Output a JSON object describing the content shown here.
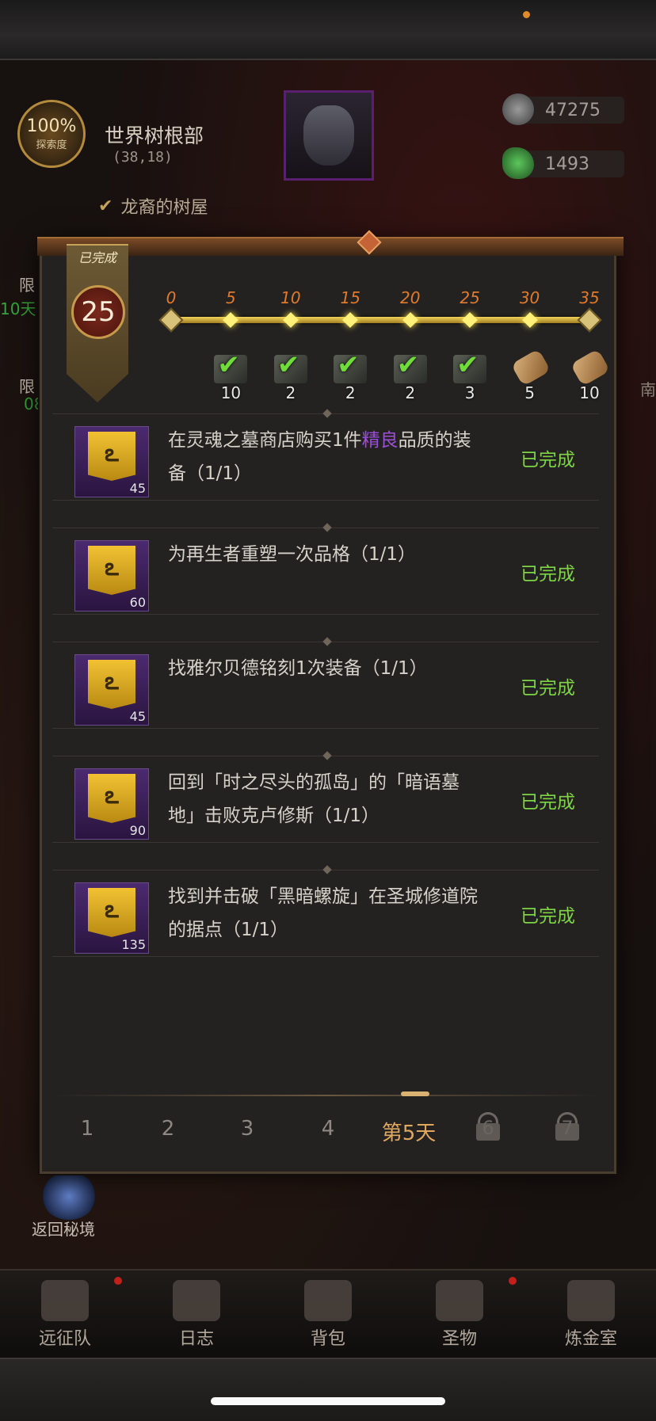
{
  "header": {
    "explore_pct": "100%",
    "explore_label": "探索度",
    "location_name": "世界树根部",
    "location_coords": "(38,18)",
    "sub_location": "龙裔的树屋",
    "currency": [
      {
        "icon": "ore-icon",
        "value": "47275"
      },
      {
        "icon": "emerald-icon",
        "value": "1493"
      }
    ]
  },
  "left_side": {
    "limited_1": "限",
    "limited_1_days": "10天",
    "limited_2": "限",
    "limited_2_days": "08",
    "return_label": "返回秘境"
  },
  "right_side": {
    "edge_text": "南"
  },
  "panel": {
    "banner_label": "已完成",
    "banner_value": "25",
    "progress": {
      "current": 35,
      "max": 35,
      "milestones": [
        "0",
        "5",
        "10",
        "15",
        "20",
        "25",
        "30",
        "35"
      ],
      "rewards": [
        {
          "milestone": "5",
          "count": "10",
          "type": "chest",
          "claimed": true
        },
        {
          "milestone": "10",
          "count": "2",
          "type": "chest",
          "claimed": true
        },
        {
          "milestone": "15",
          "count": "2",
          "type": "chest",
          "claimed": true
        },
        {
          "milestone": "20",
          "count": "2",
          "type": "chest",
          "claimed": true
        },
        {
          "milestone": "25",
          "count": "3",
          "type": "chest",
          "claimed": true
        },
        {
          "milestone": "30",
          "count": "5",
          "type": "scroll",
          "claimed": false
        },
        {
          "milestone": "35",
          "count": "10",
          "type": "scroll",
          "claimed": false
        }
      ]
    },
    "tasks": [
      {
        "reward": "45",
        "text_before": "在灵魂之墓商店购买1件",
        "text_highlight": "精良",
        "text_after": "品质的装备（1/1）",
        "status": "已完成"
      },
      {
        "reward": "60",
        "text_before": "为再生者重塑一次品格（1/1）",
        "text_highlight": "",
        "text_after": "",
        "status": "已完成"
      },
      {
        "reward": "45",
        "text_before": "找雅尔贝德铭刻1次装备（1/1）",
        "text_highlight": "",
        "text_after": "",
        "status": "已完成"
      },
      {
        "reward": "90",
        "text_before": "回到「时之尽头的孤岛」的「暗语墓地」击败克卢修斯（1/1）",
        "text_highlight": "",
        "text_after": "",
        "status": "已完成"
      },
      {
        "reward": "135",
        "text_before": "找到并击破「黑暗螺旋」在圣城修道院的据点（1/1）",
        "text_highlight": "",
        "text_after": "",
        "status": "已完成"
      }
    ],
    "days": [
      {
        "label": "1",
        "state": "normal"
      },
      {
        "label": "2",
        "state": "normal"
      },
      {
        "label": "3",
        "state": "normal"
      },
      {
        "label": "4",
        "state": "normal"
      },
      {
        "label": "第5天",
        "state": "active"
      },
      {
        "label": "6",
        "state": "locked"
      },
      {
        "label": "7",
        "state": "locked"
      }
    ]
  },
  "nav": [
    {
      "label": "远征队",
      "icon": "helmet-icon",
      "badge": true
    },
    {
      "label": "日志",
      "icon": "journal-icon",
      "badge": false
    },
    {
      "label": "背包",
      "icon": "bag-icon",
      "badge": false
    },
    {
      "label": "圣物",
      "icon": "relic-icon",
      "badge": true
    },
    {
      "label": "炼金室",
      "icon": "alchemy-icon",
      "badge": false
    }
  ],
  "colors": {
    "complete_green": "#7ed442",
    "highlight_purple": "#9c4fd6",
    "milestone_orange": "#e07a2c"
  }
}
